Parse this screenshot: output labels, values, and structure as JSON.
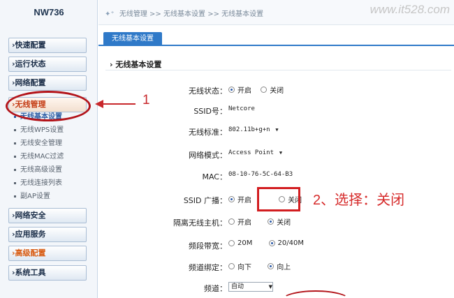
{
  "brand": "NW736",
  "breadcrumb": [
    "无线管理",
    "无线基本设置",
    "无线基本设置"
  ],
  "breadcrumb_sep": ">>",
  "watermark": "www.it528.com",
  "sidebar": {
    "items": [
      {
        "label": "›快速配置"
      },
      {
        "label": "›运行状态"
      },
      {
        "label": "›网络配置"
      },
      {
        "label": "›无线管理"
      },
      {
        "label": "›网络安全"
      },
      {
        "label": "›应用服务"
      },
      {
        "label": "›高级配置"
      },
      {
        "label": "›系统工具"
      }
    ],
    "subitems": [
      {
        "label": "无线基本设置"
      },
      {
        "label": "无线WPS设置"
      },
      {
        "label": "无线安全管理"
      },
      {
        "label": "无线MAC过滤"
      },
      {
        "label": "无线高级设置"
      },
      {
        "label": "无线连接列表"
      },
      {
        "label": "副AP设置"
      }
    ]
  },
  "tab_label": "无线基本设置",
  "section_title": "› 无线基本设置",
  "form": {
    "wireless_status": {
      "label": "无线状态：",
      "on": "开启",
      "off": "关闭"
    },
    "ssid": {
      "label": "SSID号：",
      "value": "Netcore"
    },
    "standard": {
      "label": "无线标准：",
      "value": "802.11b+g+n"
    },
    "mode": {
      "label": "网络模式：",
      "value": "Access Point"
    },
    "mac": {
      "label": "MAC：",
      "value": "08-10-76-5C-64-B3"
    },
    "ssid_broadcast": {
      "label": "SSID 广播：",
      "on": "开启",
      "off": "关闭"
    },
    "isolate": {
      "label": "隔离无线主机：",
      "on": "开启",
      "off": "关闭"
    },
    "bandwidth": {
      "label": "频段带宽：",
      "opt1": "20M",
      "opt2": "20/40M"
    },
    "channel_bind": {
      "label": "频道绑定：",
      "opt1": "向下",
      "opt2": "向上"
    },
    "channel": {
      "label": "频道：",
      "value": "自动"
    }
  },
  "annotations": {
    "step1": "1",
    "step2": "2、选择：关闭"
  },
  "colors": {
    "accent": "#2f79c8",
    "annotation_red": "#d21d20"
  }
}
